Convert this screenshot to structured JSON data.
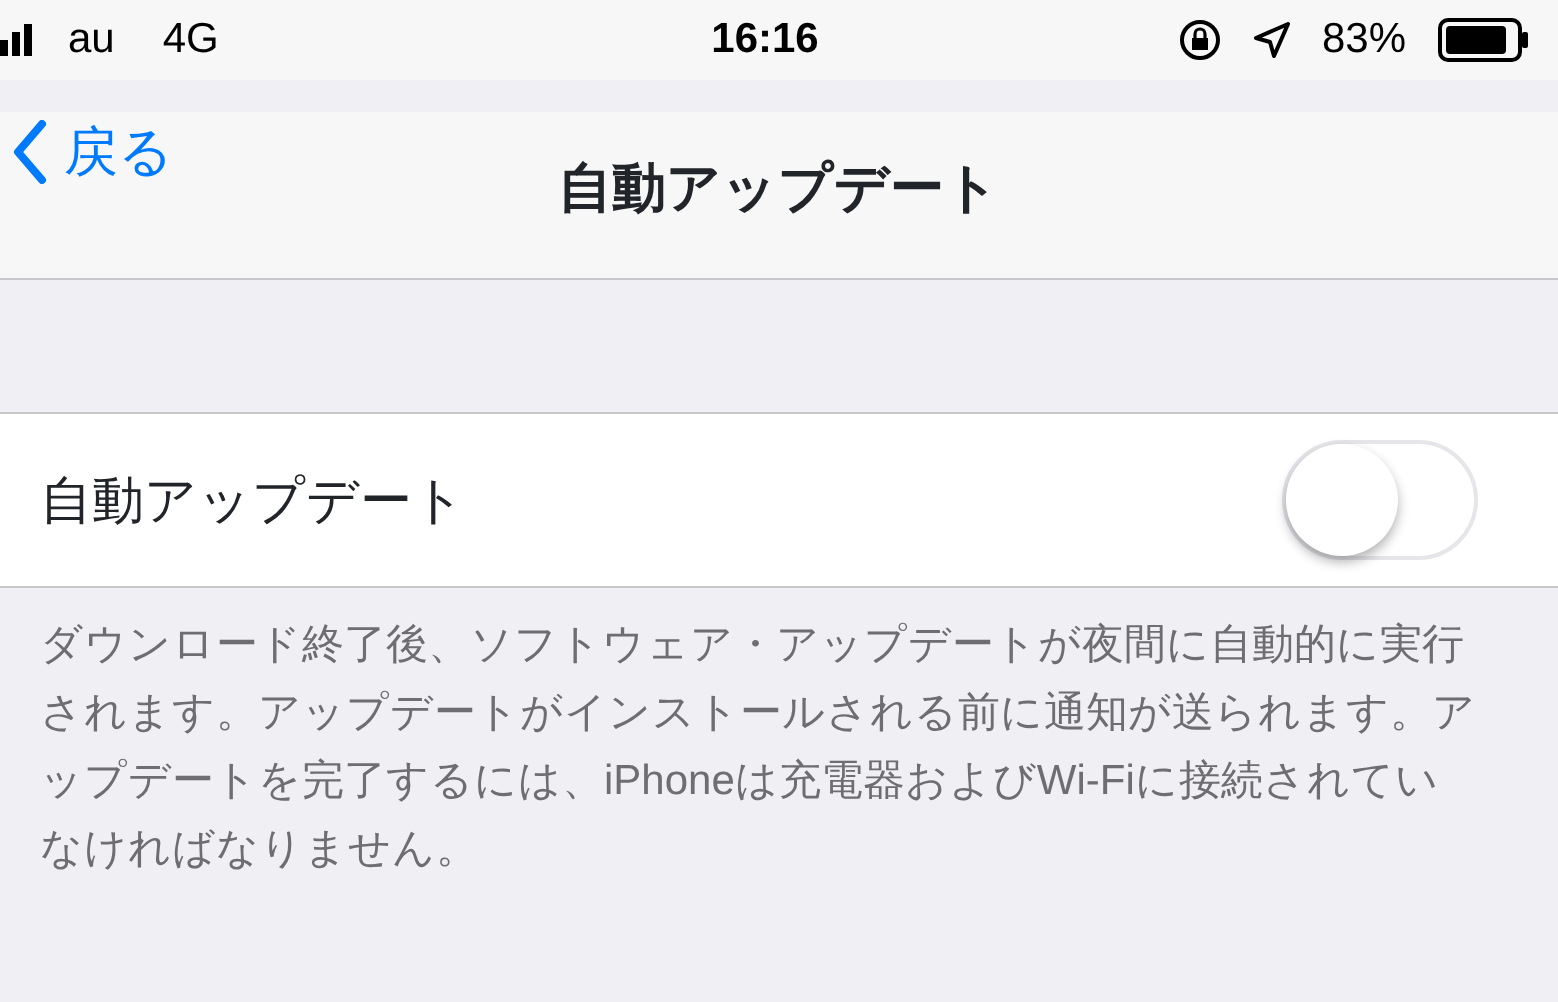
{
  "status_bar": {
    "carrier": "au",
    "network": "4G",
    "time": "16:16",
    "battery": "83%"
  },
  "nav": {
    "back": "戻る",
    "title": "自動アップデート"
  },
  "setting": {
    "label": "自動アップデート",
    "on": false
  },
  "footer": "ダウンロード終了後、ソフトウェア・アップデートが夜間に自動的に実行されます。アップデートがインストールされる前に通知が送られます。アップデートを完了するには、iPhoneは充電器およびWi-Fiに接続されていなければなりません。"
}
